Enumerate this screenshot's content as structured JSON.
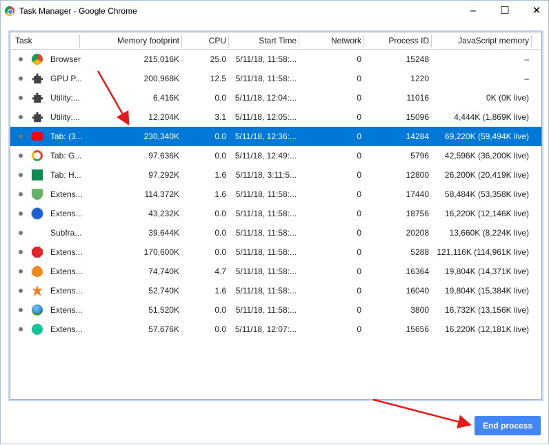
{
  "window": {
    "title": "Task Manager - Google Chrome",
    "minimize": "–",
    "maximize": "☐",
    "close": "✕"
  },
  "columns": [
    "Task",
    "Memory footprint",
    "CPU",
    "Start Time",
    "Network",
    "Process ID",
    "JavaScript memory"
  ],
  "rows": [
    {
      "icon": "chrome-icon",
      "task": "Browser",
      "mem": "215,016K",
      "cpu": "25.0",
      "start": "5/11/18, 11:58:...",
      "net": "0",
      "pid": "15248",
      "js": "–"
    },
    {
      "icon": "puzzle-icon",
      "task": "GPU P...",
      "mem": "200,968K",
      "cpu": "12.5",
      "start": "5/11/18, 11:58:...",
      "net": "0",
      "pid": "1220",
      "js": "–"
    },
    {
      "icon": "puzzle-icon",
      "task": "Utility:...",
      "mem": "6,416K",
      "cpu": "0.0",
      "start": "5/11/18, 12:04:...",
      "net": "0",
      "pid": "11016",
      "js": "0K (0K live)"
    },
    {
      "icon": "puzzle-icon",
      "task": "Utility:...",
      "mem": "12,204K",
      "cpu": "3.1",
      "start": "5/11/18, 12:05:...",
      "net": "0",
      "pid": "15096",
      "js": "4,444K (1,869K live)"
    },
    {
      "icon": "youtube-icon",
      "task": "Tab: (3...",
      "mem": "230,340K",
      "cpu": "0.0",
      "start": "5/11/18, 12:36:...",
      "net": "0",
      "pid": "14284",
      "js": "69,220K (59,494K live)",
      "selected": true
    },
    {
      "icon": "google-icon",
      "task": "Tab: G...",
      "mem": "97,636K",
      "cpu": "0.0",
      "start": "5/11/18, 12:49:...",
      "net": "0",
      "pid": "5796",
      "js": "42,596K (36,200K live)"
    },
    {
      "icon": "wn-icon",
      "task": "Tab: H...",
      "mem": "97,292K",
      "cpu": "1.6",
      "start": "5/11/18, 3:11:5...",
      "net": "0",
      "pid": "12800",
      "js": "26,200K (20,419K live)"
    },
    {
      "icon": "shield-icon",
      "task": "Extens...",
      "mem": "114,372K",
      "cpu": "1.6",
      "start": "5/11/18, 11:58:...",
      "net": "0",
      "pid": "17440",
      "js": "58,484K (53,358K live)"
    },
    {
      "icon": "a-circle-icon",
      "task": "Extens...",
      "mem": "43,232K",
      "cpu": "0.0",
      "start": "5/11/18, 11:58:...",
      "net": "0",
      "pid": "18756",
      "js": "16,220K (12,146K live)"
    },
    {
      "icon": "",
      "task": "Subfra...",
      "mem": "39,644K",
      "cpu": "0.0",
      "start": "5/11/18, 11:58:...",
      "net": "0",
      "pid": "20208",
      "js": "13,660K (8,224K live)"
    },
    {
      "icon": "stop-hand-icon",
      "task": "Extens...",
      "mem": "170,600K",
      "cpu": "0.0",
      "start": "5/11/18, 11:58:...",
      "net": "0",
      "pid": "5288",
      "js": "121,116K (114,961K live)"
    },
    {
      "icon": "fire-icon",
      "task": "Extens...",
      "mem": "74,740K",
      "cpu": "4.7",
      "start": "5/11/18, 11:58:...",
      "net": "0",
      "pid": "16364",
      "js": "19,804K (14,371K live)"
    },
    {
      "icon": "avast-icon",
      "task": "Extens...",
      "mem": "52,740K",
      "cpu": "1.6",
      "start": "5/11/18, 11:58:...",
      "net": "0",
      "pid": "16040",
      "js": "19,804K (15,384K live)"
    },
    {
      "icon": "globe-icon",
      "task": "Extens...",
      "mem": "51,520K",
      "cpu": "0.0",
      "start": "5/11/18, 11:58:...",
      "net": "0",
      "pid": "3800",
      "js": "16,732K (13,156K live)"
    },
    {
      "icon": "grammarly-icon",
      "task": "Extens...",
      "mem": "57,676K",
      "cpu": "0.0",
      "start": "5/11/18, 12:07:...",
      "net": "0",
      "pid": "15656",
      "js": "16,220K (12,181K live)"
    }
  ],
  "footer": {
    "end_process": "End process"
  },
  "colors": {
    "selection": "#0078d7",
    "button": "#4285f4",
    "arrow": "#e31b1b"
  }
}
